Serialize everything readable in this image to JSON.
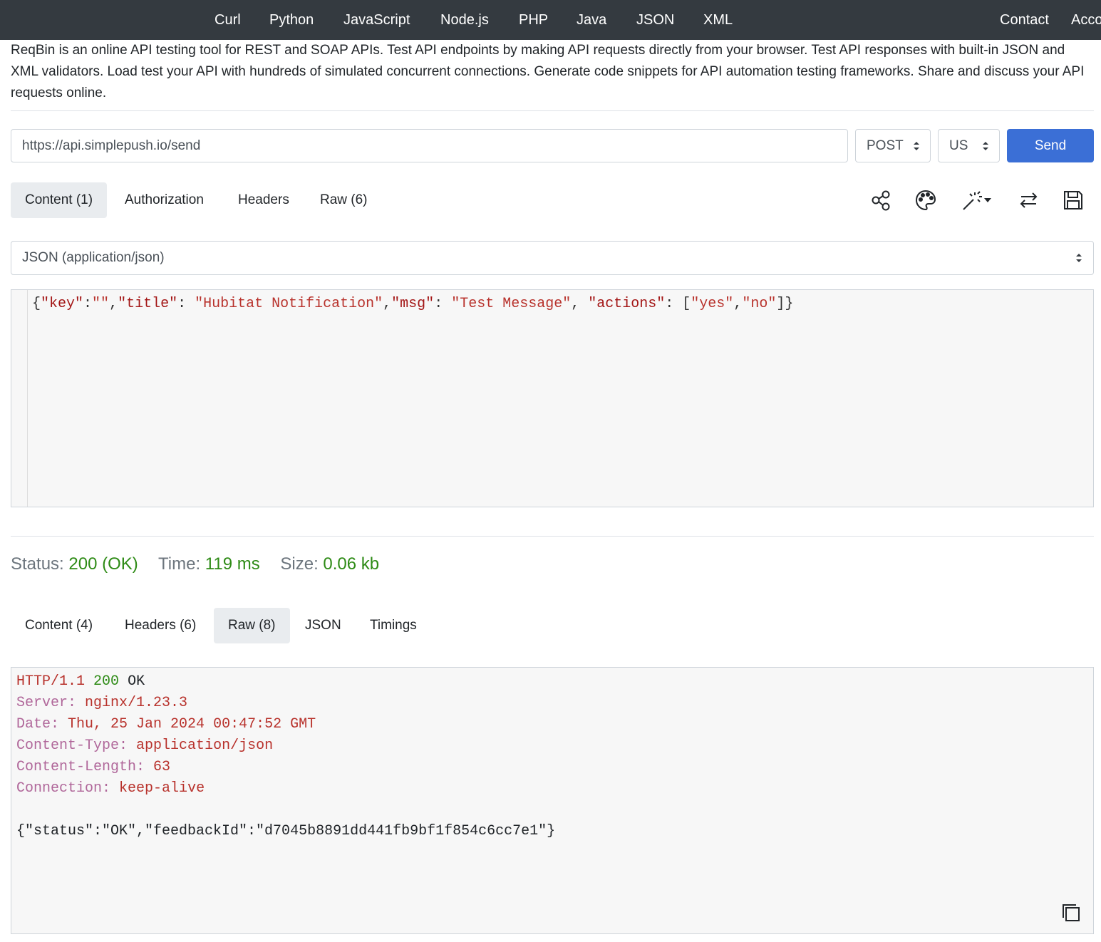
{
  "nav": {
    "links": [
      "Curl",
      "Python",
      "JavaScript",
      "Node.js",
      "PHP",
      "Java",
      "JSON",
      "XML"
    ],
    "right_links": [
      "Contact",
      "Account"
    ]
  },
  "description": "ReqBin is an online API testing tool for REST and SOAP APIs. Test API endpoints by making API requests directly from your browser. Test API responses with built-in JSON and XML validators. Load test your API with hundreds of simulated concurrent connections. Generate code snippets for API automation testing frameworks. Share and discuss your API requests online.",
  "request": {
    "url": "https://api.simplepush.io/send",
    "method": "POST",
    "region": "US",
    "send_label": "Send",
    "tabs": [
      "Content (1)",
      "Authorization",
      "Headers",
      "Raw (6)"
    ],
    "active_tab": "Content (1)",
    "content_type": "JSON (application/json)",
    "body": [
      {
        "t": "{",
        "c": "p"
      },
      {
        "t": "\"key\"",
        "c": "s"
      },
      {
        "t": ":",
        "c": "p"
      },
      {
        "t": "\"\"",
        "c": "str"
      },
      {
        "t": ",",
        "c": "p"
      },
      {
        "t": "\"title\"",
        "c": "s"
      },
      {
        "t": ": ",
        "c": "p"
      },
      {
        "t": "\"Hubitat Notification\"",
        "c": "str"
      },
      {
        "t": ",",
        "c": "p"
      },
      {
        "t": "\"msg\"",
        "c": "s"
      },
      {
        "t": ": ",
        "c": "p"
      },
      {
        "t": "\"Test Message\"",
        "c": "str"
      },
      {
        "t": ", ",
        "c": "p"
      },
      {
        "t": "\"actions\"",
        "c": "s"
      },
      {
        "t": ": [",
        "c": "p"
      },
      {
        "t": "\"yes\"",
        "c": "str"
      },
      {
        "t": ",",
        "c": "p"
      },
      {
        "t": "\"no\"",
        "c": "str"
      },
      {
        "t": "]}",
        "c": "p"
      }
    ],
    "toolbar_icons": [
      "share-icon",
      "palette-icon",
      "magic-wand-icon",
      "swap-icon",
      "save-icon"
    ]
  },
  "status": {
    "status_label": "Status:",
    "status_value": "200 (OK)",
    "time_label": "Time:",
    "time_value": "119 ms",
    "size_label": "Size:",
    "size_value": "0.06 kb"
  },
  "response": {
    "tabs": [
      "Content (4)",
      "Headers (6)",
      "Raw (8)",
      "JSON",
      "Timings"
    ],
    "active_tab": "Raw (8)",
    "status_line": {
      "protocol": "HTTP/1.1",
      "code": "200",
      "text": "OK"
    },
    "headers": [
      {
        "key": "Server:",
        "value": "nginx/1.23.3"
      },
      {
        "key": "Date:",
        "value": "Thu, 25 Jan 2024 00:47:52 GMT"
      },
      {
        "key": "Content-Type:",
        "value": "application/json"
      },
      {
        "key": "Content-Length:",
        "value": "63"
      },
      {
        "key": "Connection:",
        "value": "keep-alive"
      }
    ],
    "body": "{\"status\":\"OK\",\"feedbackId\":\"d7045b8891dd441fb9bf1f854c6cc7e1\"}"
  },
  "colors": {
    "nav_bg": "#343a40",
    "send_button": "#3b6fd6",
    "status_ok": "#2e8b16",
    "json_key": "#a31515",
    "header_key": "#b0679a"
  }
}
